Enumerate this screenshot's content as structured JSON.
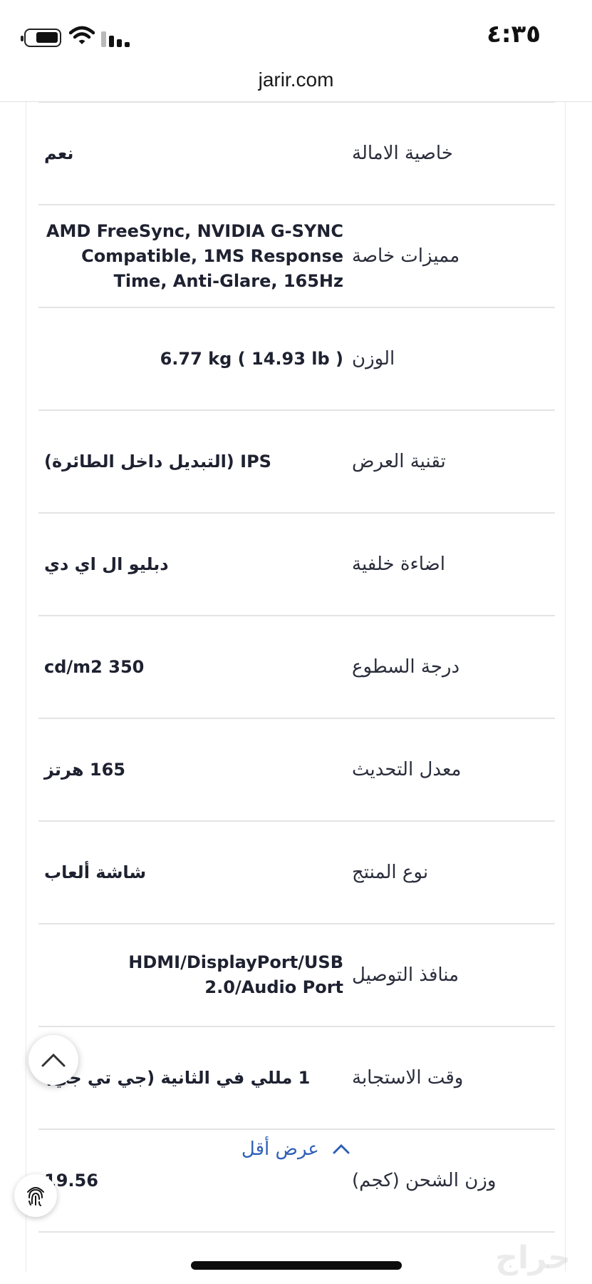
{
  "status_bar": {
    "time": "٤:٣٥"
  },
  "browser": {
    "url": "jarir.com"
  },
  "specs": [
    {
      "label": "خاصية الامالة",
      "value": "نعم",
      "dir": "rtl"
    },
    {
      "label": "مميزات خاصة",
      "value": "AMD FreeSync, NVIDIA G-SYNC Compatible, 1MS Response Time, Anti-Glare, 165Hz",
      "dir": "ltr"
    },
    {
      "label": "الوزن",
      "value": "6.77 kg ( 14.93 lb )",
      "dir": "ltr"
    },
    {
      "label": "تقنية العرض",
      "value": "IPS (التبديل داخل الطائرة)",
      "dir": "rtl"
    },
    {
      "label": "اضاءة خلفية",
      "value": "دبليو ال اي دي",
      "dir": "rtl"
    },
    {
      "label": "درجة السطوع",
      "value": "350 cd/m2",
      "dir": "rtl"
    },
    {
      "label": "معدل التحديث",
      "value": "165 هرتز",
      "dir": "rtl"
    },
    {
      "label": "نوع المنتج",
      "value": "شاشة ألعاب",
      "dir": "rtl"
    },
    {
      "label": "منافذ التوصيل",
      "value": "HDMI/DisplayPort/USB 2.0/Audio Port",
      "dir": "ltr"
    },
    {
      "label": "وقت الاستجابة",
      "value": "1 مللي في الثانية (جي تي جي)",
      "dir": "rtl"
    },
    {
      "label": "وزن الشحن (كجم)",
      "value": "19.56",
      "dir": "rtl"
    }
  ],
  "show_less": {
    "label": "عرض أقل"
  },
  "watermark": "حراج"
}
